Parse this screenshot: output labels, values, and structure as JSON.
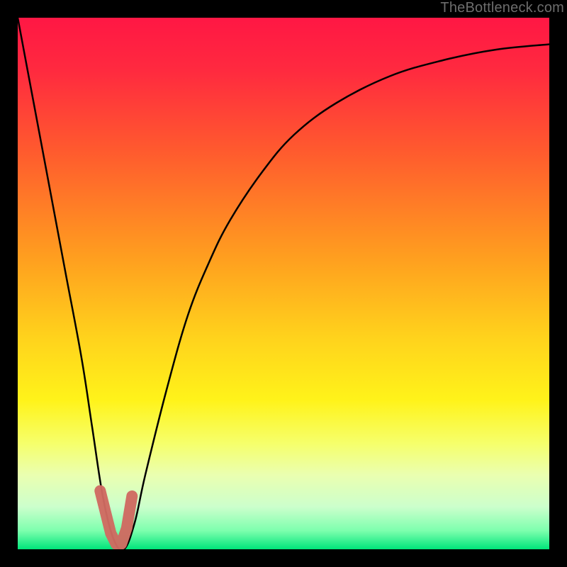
{
  "watermark": "TheBottleneck.com",
  "colors": {
    "frame": "#000000",
    "watermark_text": "#6d6d6d",
    "curve_stroke": "#000000",
    "marker_stroke": "#cf6a61",
    "gradient_stops": [
      {
        "offset": 0.0,
        "color": "#ff1744"
      },
      {
        "offset": 0.1,
        "color": "#ff2a3f"
      },
      {
        "offset": 0.25,
        "color": "#ff5a2e"
      },
      {
        "offset": 0.45,
        "color": "#ff9e1f"
      },
      {
        "offset": 0.6,
        "color": "#ffd21c"
      },
      {
        "offset": 0.72,
        "color": "#fff31a"
      },
      {
        "offset": 0.8,
        "color": "#f6ff6a"
      },
      {
        "offset": 0.86,
        "color": "#eaffb0"
      },
      {
        "offset": 0.92,
        "color": "#ccffcc"
      },
      {
        "offset": 0.965,
        "color": "#7dffae"
      },
      {
        "offset": 1.0,
        "color": "#00e57a"
      }
    ]
  },
  "chart_data": {
    "type": "line",
    "title": "",
    "xlabel": "",
    "ylabel": "",
    "xlim": [
      0,
      100
    ],
    "ylim": [
      0,
      100
    ],
    "grid": false,
    "legend": false,
    "series": [
      {
        "name": "bottleneck-curve",
        "x": [
          0,
          3,
          6,
          9,
          12,
          14,
          16,
          18,
          20,
          22,
          24,
          28,
          32,
          36,
          40,
          46,
          52,
          60,
          70,
          80,
          90,
          100
        ],
        "values": [
          100,
          84,
          68,
          52,
          36,
          23,
          10,
          2,
          0,
          5,
          14,
          30,
          44,
          54,
          62,
          71,
          78,
          84,
          89,
          92,
          94,
          95
        ]
      }
    ],
    "marker": {
      "name": "highlight-range",
      "x": [
        15.5,
        16.5,
        17.5,
        18.5,
        19.5,
        20.5,
        21.5
      ],
      "values": [
        11,
        7,
        3,
        1,
        1,
        4,
        10
      ]
    }
  }
}
